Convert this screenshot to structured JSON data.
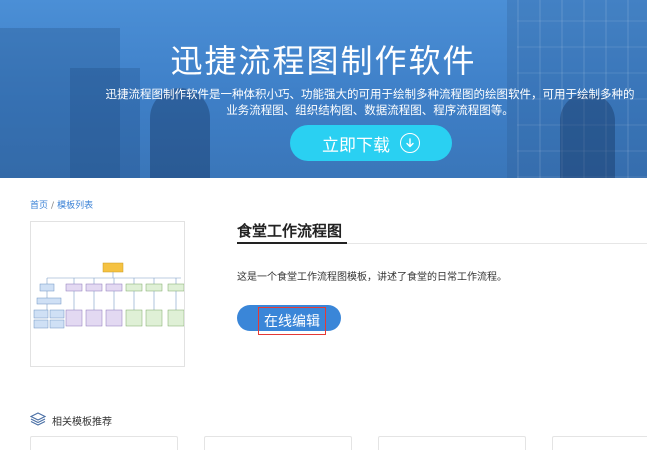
{
  "banner": {
    "title": "迅捷流程图制作软件",
    "description": "迅捷流程图制作软件是一种体积小巧、功能强大的可用于绘制多种流程图的绘图软件，可用于绘制多种的业务流程图、组织结构图、数据流程图、程序流程图等。",
    "download_label": "立即下载",
    "download_icon": "download-circle-icon",
    "colors": {
      "background": "#4287d1",
      "button": "#2ad0f2"
    }
  },
  "breadcrumb": {
    "home": "首页",
    "separator": "/",
    "current": "模板列表"
  },
  "template": {
    "title": "食堂工作流程图",
    "description": "这是一个食堂工作流程图模板，讲述了食堂的日常工作流程。",
    "edit_label": "在线编辑",
    "colors": {
      "button": "#3a86d8",
      "highlight": "#e53935"
    }
  },
  "related": {
    "heading": "相关模板推荐",
    "icon": "layers-icon"
  }
}
